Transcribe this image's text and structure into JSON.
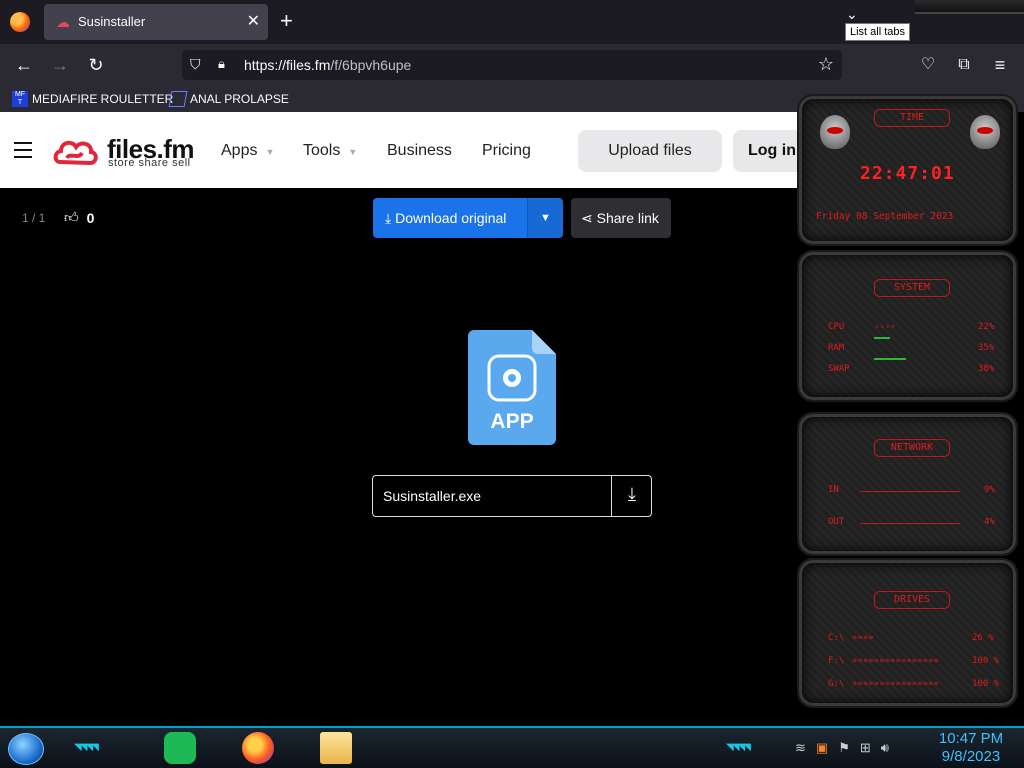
{
  "browser": {
    "tab_title": "Susinstaller",
    "tab_close": "✕",
    "new_tab": "+",
    "list_tabs_tooltip": "List all tabs",
    "url_host": "https://files.fm",
    "url_path": "/f/6bpvh6upe",
    "bookmarks": [
      {
        "label": "MEDIAFIRE ROULETTER",
        "icon": "MF T"
      },
      {
        "label": "ANAL PROLAPSE",
        "icon": ""
      }
    ]
  },
  "site": {
    "logo_text": "files.fm",
    "logo_tagline": "store share sell",
    "nav": [
      "Apps",
      "Tools",
      "Business",
      "Pricing"
    ],
    "upload_label": "Upload files",
    "login_label": "Log in"
  },
  "viewer": {
    "page_count": "1 / 1",
    "like_count": "0",
    "download_label": "Download original",
    "share_label": "Share link",
    "file_type": "APP",
    "filename": "Susinstaller.exe"
  },
  "gadget": {
    "time_title": "TIME",
    "time": "22:47:01",
    "date": "Friday 08 September 2023",
    "system_title": "SYSTEM",
    "system_rows": [
      {
        "label": "CPU",
        "value": "22%"
      },
      {
        "label": "RAM",
        "value": "35%"
      },
      {
        "label": "SWAP",
        "value": "38%"
      }
    ],
    "network_title": "NETWORK",
    "network_rows": [
      {
        "label": "IN",
        "value": "9%"
      },
      {
        "label": "OUT",
        "value": "4%"
      }
    ],
    "drives_title": "DRIVES",
    "drive_rows": [
      {
        "label": "C:\\",
        "value": "26 %"
      },
      {
        "label": "F:\\",
        "value": "100 %"
      },
      {
        "label": "G:\\",
        "value": "100 %"
      }
    ]
  },
  "taskbar": {
    "time": "10:47 PM",
    "date": "9/8/2023"
  }
}
